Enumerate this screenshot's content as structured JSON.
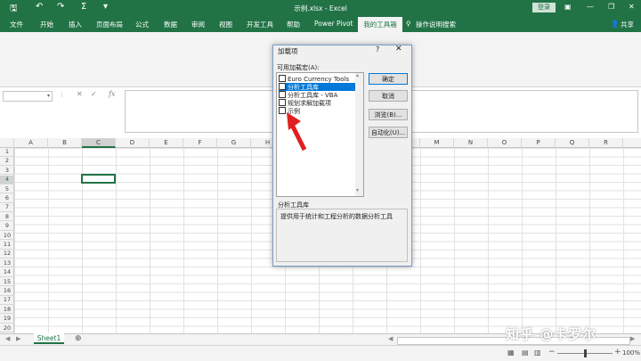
{
  "titlebar": {
    "title": "示例.xlsx  -  Excel",
    "login": "登录"
  },
  "tabs": [
    "文件",
    "开始",
    "插入",
    "页面布局",
    "公式",
    "数据",
    "审阅",
    "视图",
    "开发工具",
    "帮助",
    "Power Pivot"
  ],
  "active_tab": "我的工具箱",
  "tell_me": "操作说明搜索",
  "share": "共享",
  "formula_bar": {
    "fx": "fx"
  },
  "columns": [
    "A",
    "B",
    "C",
    "D",
    "E",
    "F",
    "G",
    "H",
    "I",
    "J",
    "K",
    "L",
    "M",
    "N",
    "O",
    "P",
    "Q",
    "R"
  ],
  "rows": [
    "1",
    "2",
    "3",
    "4",
    "5",
    "6",
    "7",
    "8",
    "9",
    "10",
    "11",
    "12",
    "13",
    "14",
    "15",
    "16",
    "17",
    "18",
    "19",
    "20"
  ],
  "sheet": {
    "tab": "Sheet1"
  },
  "status": {
    "zoom": "100%"
  },
  "dialog": {
    "title": "加载项",
    "help": "?",
    "close": "✕",
    "list_label": "可用加载宏(A):",
    "items": [
      {
        "label": "Euro Currency Tools",
        "checked": false,
        "selected": false
      },
      {
        "label": "分析工具库",
        "checked": false,
        "selected": true
      },
      {
        "label": "分析工具库 - VBA",
        "checked": false,
        "selected": false
      },
      {
        "label": "规划求解加载项",
        "checked": false,
        "selected": false
      },
      {
        "label": "示例",
        "checked": false,
        "selected": false
      }
    ],
    "buttons": {
      "ok": "确定",
      "cancel": "取消",
      "browse": "浏览(B)...",
      "automation": "自动化(U)..."
    },
    "desc_title": "分析工具库",
    "desc_text": "提供用于统计和工程分析的数据分析工具"
  },
  "watermark": "知乎 @卡罗尔"
}
